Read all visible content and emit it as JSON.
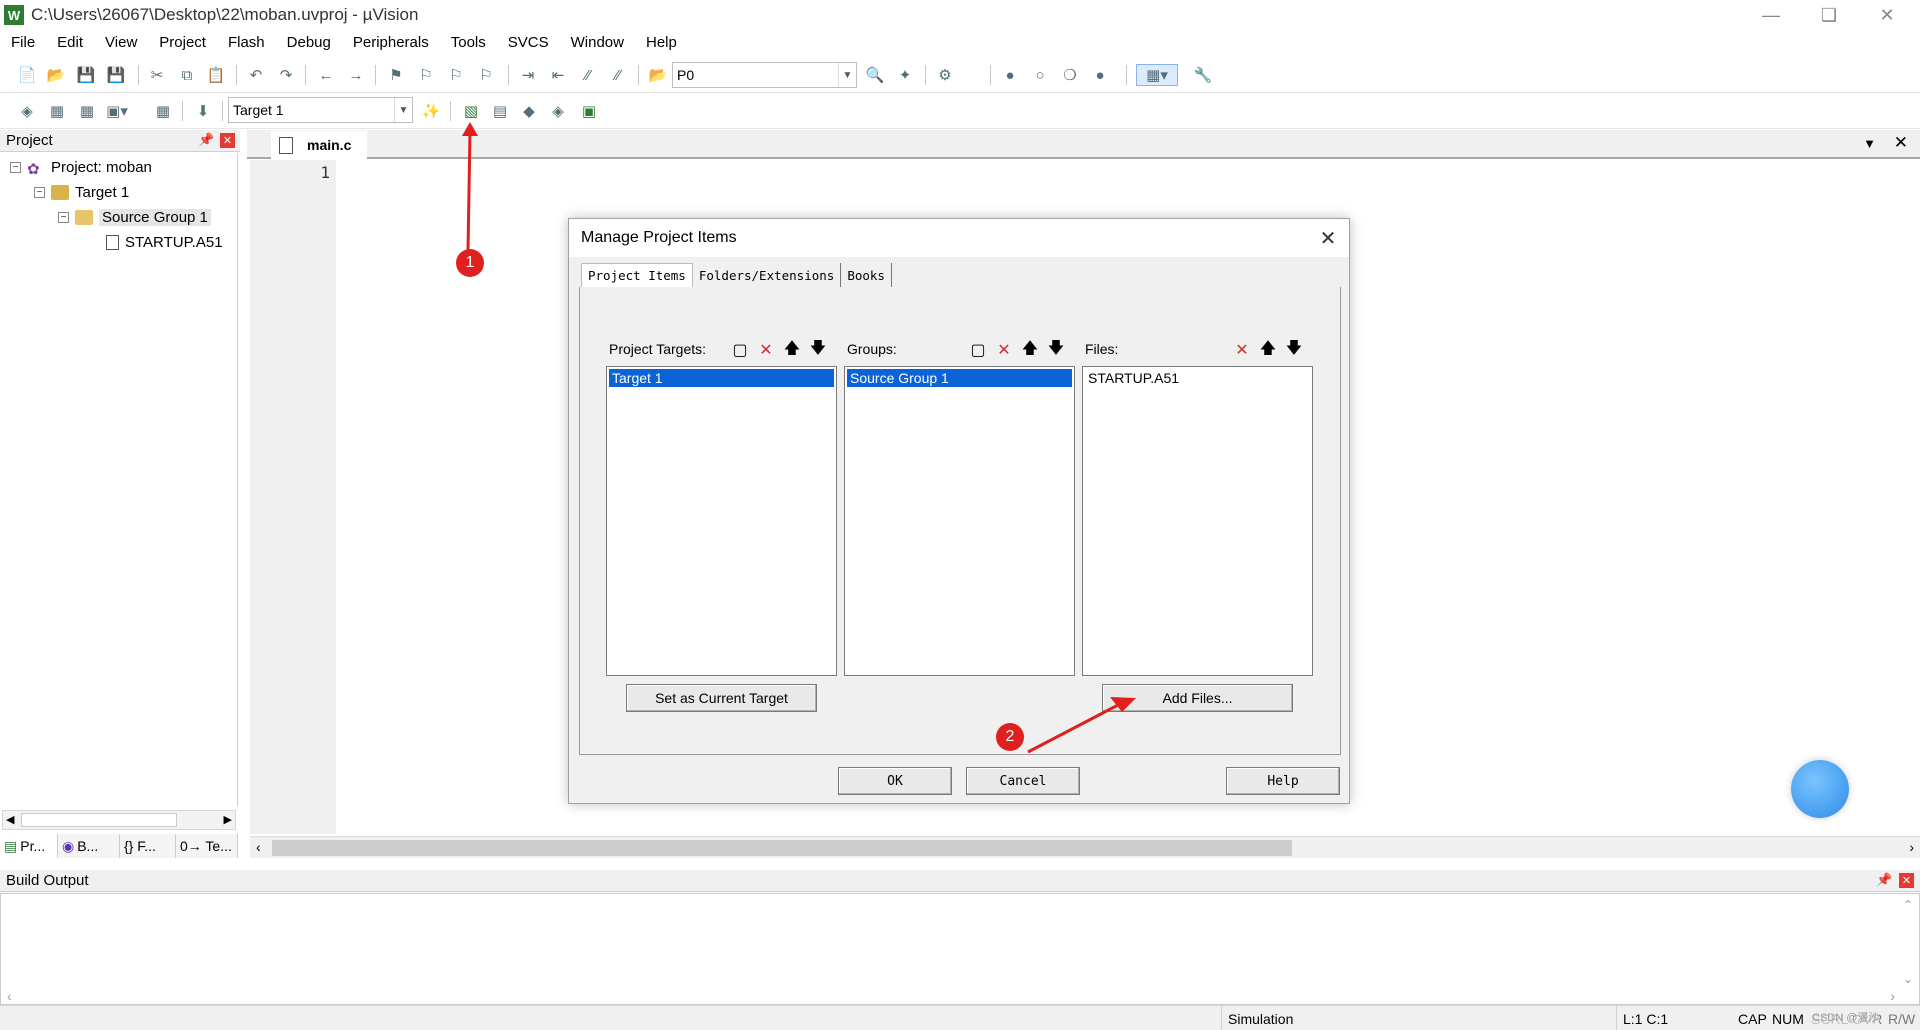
{
  "window": {
    "title": "C:\\Users\\26067\\Desktop\\22\\moban.uvproj - µVision",
    "app_icon": "uvision-logo",
    "controls": [
      "minimize",
      "restore",
      "close"
    ]
  },
  "menu": [
    "File",
    "Edit",
    "View",
    "Project",
    "Flash",
    "Debug",
    "Peripherals",
    "Tools",
    "SVCS",
    "Window",
    "Help"
  ],
  "toolbar1": {
    "find_combo_value": "P0"
  },
  "toolbar2": {
    "target_combo_value": "Target 1"
  },
  "project_panel": {
    "title": "Project",
    "tree": {
      "project": "Project: moban",
      "target": "Target 1",
      "group": "Source Group 1",
      "file": "STARTUP.A51"
    },
    "bottom_tabs": [
      "Pr...",
      "B...",
      "{} F...",
      "0→ Te..."
    ]
  },
  "editor": {
    "tab": "main.c",
    "line_numbers": [
      "1"
    ]
  },
  "build_output": {
    "title": "Build Output"
  },
  "status_bar": {
    "mode": "Simulation",
    "position": "L:1 C:1",
    "indicators": [
      "CAP",
      "NUM",
      "SCRL",
      "OVR",
      "R/W"
    ]
  },
  "dialog": {
    "title": "Manage Project Items",
    "tabs": [
      "Project Items",
      "Folders/Extensions",
      "Books"
    ],
    "targets_label": "Project Targets:",
    "groups_label": "Groups:",
    "files_label": "Files:",
    "targets": [
      "Target 1"
    ],
    "groups": [
      "Source Group 1"
    ],
    "files": [
      "STARTUP.A51"
    ],
    "set_current_target": "Set as Current Target",
    "add_files": "Add Files...",
    "ok": "OK",
    "cancel": "Cancel",
    "help": "Help"
  },
  "annotations": {
    "badge1": "1",
    "badge2": "2",
    "color": "#e02020"
  },
  "watermark": "CSDN @漫沙"
}
